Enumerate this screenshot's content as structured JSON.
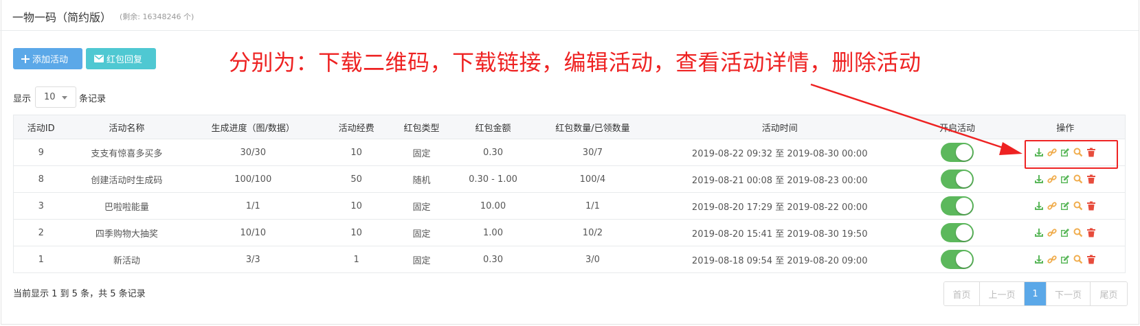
{
  "header": {
    "title": "一物一码（简约版）",
    "remaining": "(剩余: 16348246 个)"
  },
  "toolbar": {
    "add_label": "添加活动",
    "reply_label": "红包回复"
  },
  "annotation": "分别为：下载二维码，下载链接，编辑活动，查看活动详情，删除活动",
  "length_menu": {
    "prefix": "显示",
    "value": "10",
    "suffix": "条记录"
  },
  "table": {
    "headers": [
      "活动ID",
      "活动名称",
      "生成进度（图/数据）",
      "活动经费",
      "红包类型",
      "红包金额",
      "红包数量/已领数量",
      "活动时间",
      "开启活动",
      "操作"
    ],
    "rows": [
      {
        "id": "9",
        "name": "支支有惊喜多买多",
        "progress": "30/30",
        "budget": "10",
        "type": "固定",
        "amount": "0.30",
        "count": "30/7",
        "time": "2019-08-22 09:32 至 2019-08-30 00:00",
        "enabled": true
      },
      {
        "id": "8",
        "name": "创建活动时生成码",
        "progress": "100/100",
        "budget": "50",
        "type": "随机",
        "amount": "0.30 - 1.00",
        "count": "100/4",
        "time": "2019-08-21 00:08 至 2019-08-23 00:00",
        "enabled": true
      },
      {
        "id": "3",
        "name": "巴啦啦能量",
        "progress": "1/1",
        "budget": "10",
        "type": "固定",
        "amount": "10.00",
        "count": "1/1",
        "time": "2019-08-20 17:29 至 2019-08-22 00:00",
        "enabled": true
      },
      {
        "id": "2",
        "name": "四季购物大抽奖",
        "progress": "10/10",
        "budget": "10",
        "type": "固定",
        "amount": "1.00",
        "count": "10/2",
        "time": "2019-08-20 15:41 至 2019-08-30 19:50",
        "enabled": true
      },
      {
        "id": "1",
        "name": "新活动",
        "progress": "3/3",
        "budget": "1",
        "type": "固定",
        "amount": "0.30",
        "count": "3/0",
        "time": "2019-08-18 09:54 至 2019-08-20 09:00",
        "enabled": true
      }
    ],
    "op_icons": [
      "download-icon",
      "link-icon",
      "edit-icon",
      "search-icon",
      "trash-icon"
    ]
  },
  "footer": {
    "info": "当前显示 1 到 5 条，共 5 条记录"
  },
  "pagination": {
    "first": "首页",
    "prev": "上一页",
    "current": "1",
    "next": "下一页",
    "last": "尾页"
  },
  "colors": {
    "primary": "#5ba8e8",
    "info": "#4fc8d2",
    "success": "#5cb85c",
    "warning": "#f0ad4e",
    "danger": "#e74c3c",
    "annotation": "#ee2222"
  }
}
